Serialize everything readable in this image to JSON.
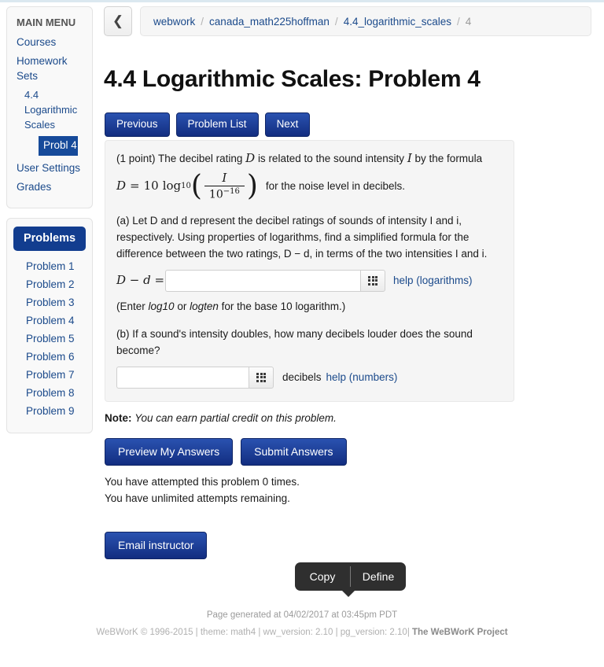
{
  "sidebar": {
    "menu_title": "MAIN MENU",
    "items": [
      {
        "label": "Courses",
        "level": "top",
        "active": false
      },
      {
        "label": "Homework Sets",
        "level": "top",
        "active": false
      },
      {
        "label": "4.4 Logarithmic Scales",
        "level": "sub",
        "active": false
      },
      {
        "label": "Probl 4",
        "level": "sub",
        "active": true
      },
      {
        "label": "User Settings",
        "level": "top",
        "active": false
      },
      {
        "label": "Grades",
        "level": "top",
        "active": false
      }
    ],
    "problems_header": "Problems",
    "problems": [
      "Problem 1",
      "Problem 2",
      "Problem 3",
      "Problem 4",
      "Problem 5",
      "Problem 6",
      "Problem 7",
      "Problem 8",
      "Problem 9"
    ]
  },
  "breadcrumb": {
    "back_icon": "chevron-left-icon",
    "separator": "/",
    "items": [
      "webwork",
      "canada_math225hoffman",
      "4.4_logarithmic_scales",
      "4"
    ]
  },
  "page_title": "4.4 Logarithmic Scales: Problem 4",
  "nav_buttons": [
    {
      "label": "Previous"
    },
    {
      "label": "Problem List"
    },
    {
      "label": "Next"
    }
  ],
  "problem": {
    "points": "(1 point)",
    "intro_before": "The decibel rating",
    "intro_var_D": "D",
    "intro_mid": "is related to the sound intensity",
    "intro_var_I": "I",
    "intro_after": "by the formula",
    "formula": {
      "lhs": "D",
      "equals": "=",
      "coefficient": "10",
      "log": "log",
      "log_base": "10",
      "numerator": "I",
      "denominator_base": "10",
      "denominator_exp": "−16",
      "tail": "for the noise level in decibels."
    },
    "part_a": {
      "text": "(a) Let D and d represent the decibel ratings of sounds of intensity I and i, respectively. Using properties of logarithms, find a simplified formula for the difference between the two ratings, D − d, in terms of the two intensities I and i.",
      "label": "D − d =",
      "input_value": "",
      "input_placeholder": "",
      "grid_icon": "keypad-grid-icon",
      "help_link": "help (logarithms)",
      "hint_before": "(Enter ",
      "hint_em1": "log10",
      "hint_mid": " or ",
      "hint_em2": "logten",
      "hint_after": " for the base 10 logarithm.)"
    },
    "part_b": {
      "text": "(b) If a sound's intensity doubles, how many decibels louder does the sound become?",
      "input_value": "",
      "input_placeholder": "",
      "grid_icon": "keypad-grid-icon",
      "unit": "decibels",
      "help_link": "help (numbers)"
    }
  },
  "note": {
    "label": "Note:",
    "text": "You can earn partial credit on this problem."
  },
  "answer_buttons": [
    {
      "label": "Preview My Answers"
    },
    {
      "label": "Submit Answers"
    }
  ],
  "attempts": {
    "line1": "You have attempted this problem 0 times.",
    "line2": "You have unlimited attempts remaining."
  },
  "email_button": {
    "label": "Email instructor"
  },
  "context_menu": {
    "copy": "Copy",
    "define": "Define"
  },
  "footer": {
    "generated": "Page generated at 04/02/2017 at 03:45pm PDT",
    "credits_prefix": "WeBWorK © 1996-2015 | theme: math4 | ww_version: 2.10 | pg_version: 2.10| ",
    "credits_project": "The WeBWorK Project"
  },
  "colors": {
    "accent_blue": "#123d8f",
    "link_blue": "#1b4a8b",
    "panel_bg": "#f9f9f9",
    "problem_bg": "#f5f5f5",
    "menu_dark": "#2f2f2f"
  }
}
